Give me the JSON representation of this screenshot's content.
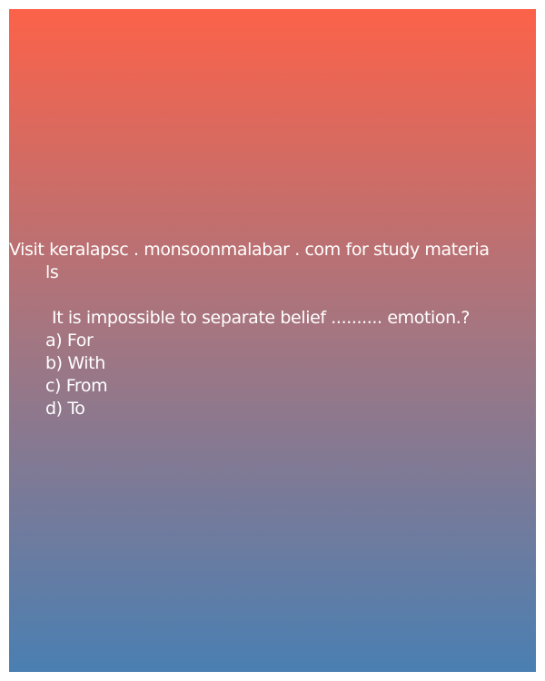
{
  "promo": {
    "line1": "Visit keralapsc . monsoonmalabar . com for study materia",
    "line2": "ls"
  },
  "question": {
    "text": "It is impossible to separate belief .......... emotion.?",
    "options": [
      "a) For",
      "b) With",
      "c) From",
      "d) To"
    ]
  },
  "colors": {
    "gradient_top": "#fc6249",
    "gradient_middle": "#a27682",
    "gradient_bottom": "#4a7fb2",
    "text": "#ffffff"
  }
}
